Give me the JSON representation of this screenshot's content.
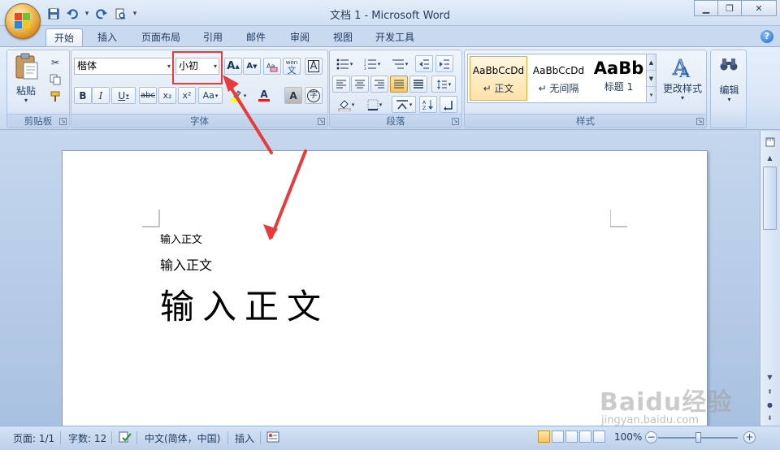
{
  "window": {
    "title": "文档 1 - Microsoft Word",
    "controls": [
      "minimize-icon",
      "restore-icon",
      "close-icon"
    ]
  },
  "quick_access": [
    "save-icon",
    "undo-icon",
    "redo-icon",
    "print-preview-icon",
    "customize-icon"
  ],
  "tabs": [
    {
      "label": "开始",
      "active": true
    },
    {
      "label": "插入"
    },
    {
      "label": "页面布局"
    },
    {
      "label": "引用"
    },
    {
      "label": "邮件"
    },
    {
      "label": "审阅"
    },
    {
      "label": "视图"
    },
    {
      "label": "开发工具"
    }
  ],
  "ribbon": {
    "clipboard": {
      "label": "剪贴板",
      "paste_label": "粘贴"
    },
    "font": {
      "label": "字体",
      "font_name": "楷体",
      "font_size": "小初",
      "bold": "B",
      "italic": "I",
      "underline": "U",
      "strike": "abc",
      "subscript": "x₂",
      "superscript": "x²",
      "case": "Aa",
      "grow": "A",
      "shrink": "A",
      "text_color": "A",
      "char_shading": "A",
      "pinyin": "wén",
      "enclose": "字"
    },
    "paragraph": {
      "label": "段落"
    },
    "styles": {
      "label": "样式",
      "items": [
        {
          "sample": "AaBbCcDd",
          "name": "↵ 正文",
          "active": true
        },
        {
          "sample": "AaBbCcDd",
          "name": "↵ 无间隔"
        },
        {
          "sample": "AaBb",
          "name": "标题 1"
        }
      ],
      "change_styles_label": "更改样式"
    },
    "editing": {
      "label": "编辑"
    }
  },
  "document": {
    "lines": [
      {
        "text": "输入正文",
        "size": "small"
      },
      {
        "text": "输入正文",
        "size": "medium"
      },
      {
        "text": "输入正文",
        "size": "large"
      }
    ]
  },
  "statusbar": {
    "page": "页面: 1/1",
    "words": "字数: 12",
    "language": "中文(简体，中国)",
    "insert_mode": "插入",
    "zoom": "100%"
  },
  "watermark": {
    "main": "Baidu经验",
    "sub": "jingyan.baidu.com"
  },
  "colors": {
    "accent": "#1e395b",
    "highlight_box": "#e83a3a",
    "arrow": "#e83a3a"
  }
}
